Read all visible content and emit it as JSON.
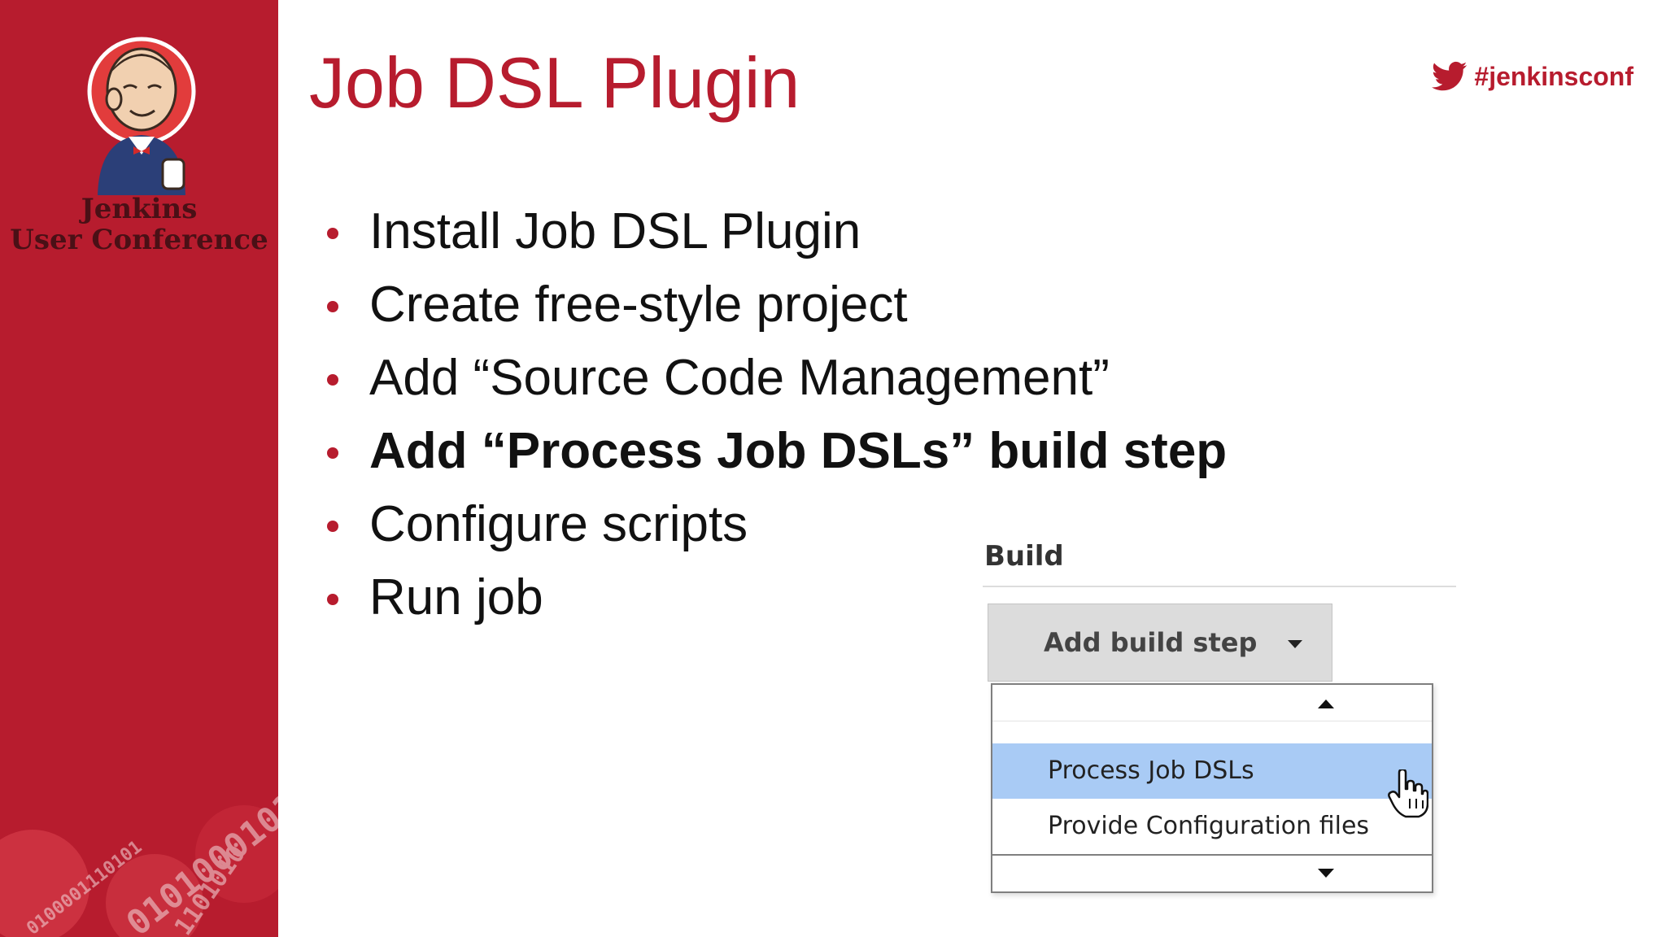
{
  "sidebar": {
    "conference_line1": "Jenkins",
    "conference_line2": "User Conference",
    "logo_icon": "jenkins-butler-logo",
    "decoration_icon": "binary-digits-art"
  },
  "header": {
    "title": "Job DSL Plugin",
    "hashtag": "#jenkinsconf",
    "hashtag_icon": "twitter-bird-icon"
  },
  "bullets": [
    {
      "text": "Install Job DSL Plugin",
      "emphasis": false
    },
    {
      "text": "Create free-style project",
      "emphasis": false
    },
    {
      "text": "Add “Source Code Management”",
      "emphasis": false
    },
    {
      "text": "Add “Process Job DSLs” build step",
      "emphasis": true
    },
    {
      "text": "Configure scripts",
      "emphasis": false
    },
    {
      "text": "Run job",
      "emphasis": false
    }
  ],
  "build_panel": {
    "heading": "Build",
    "add_step_label": "Add build step",
    "dropdown_items": [
      {
        "label": "Process Job DSLs",
        "highlighted": true
      },
      {
        "label": "Provide Configuration files",
        "highlighted": false
      }
    ]
  },
  "colors": {
    "brand_red": "#b71c2e",
    "highlight_blue": "#a9cbf5",
    "button_gray": "#dcdcdc"
  }
}
